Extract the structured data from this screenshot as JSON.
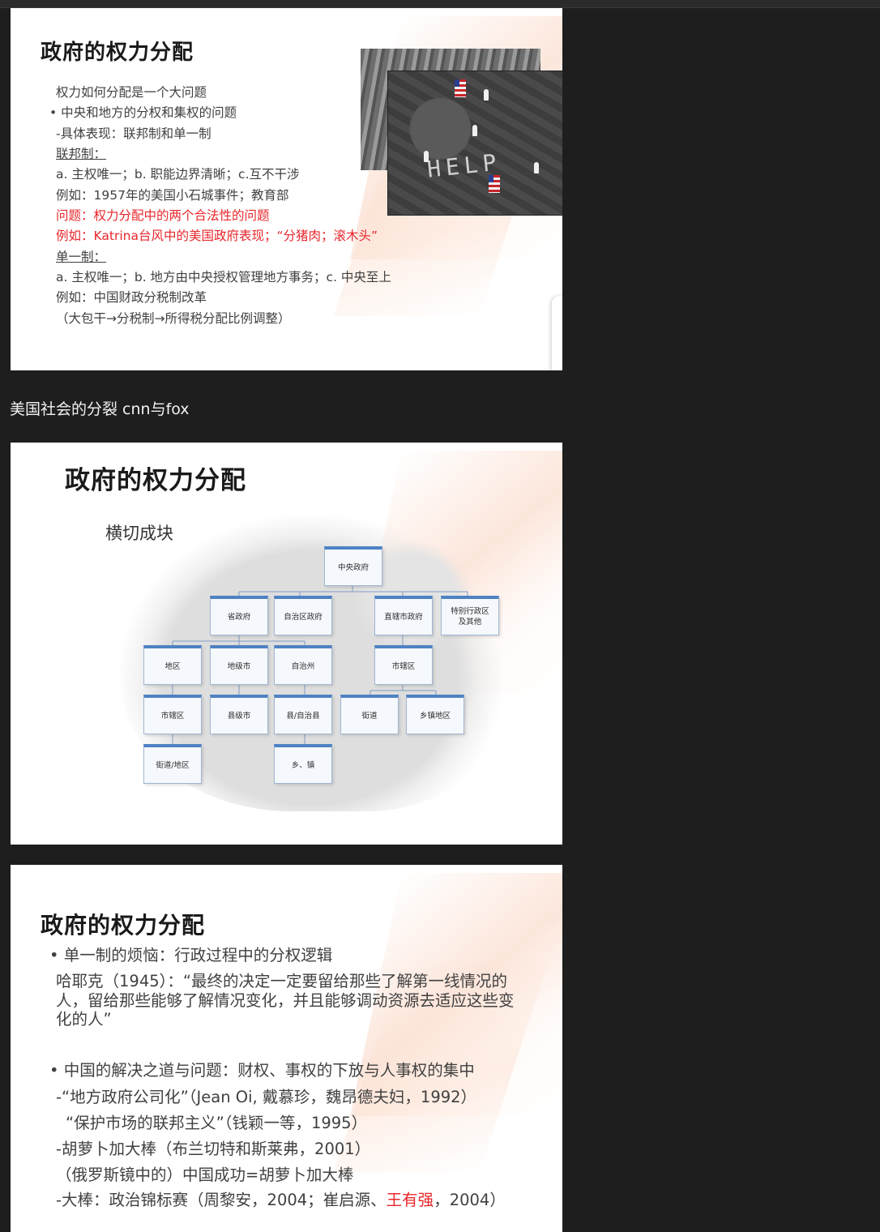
{
  "slide1": {
    "title": "政府的权力分配",
    "lines": [
      {
        "text": "权力如何分配是一个大问题"
      },
      {
        "text": "• 中央和地方的分权和集权的问题"
      },
      {
        "text": "-具体表现：联邦制和单一制"
      },
      {
        "text": "联邦制："
      },
      {
        "text": "a. 主权唯一；b. 职能边界清晰；c.互不干涉"
      },
      {
        "text": "例如：1957年的美国小石城事件；教育部"
      },
      {
        "text": "问题：权力分配中的两个合法性的问题"
      },
      {
        "text": "例如：Katrina台风中的美国政府表现；“分猪肉；滚木头”"
      },
      {
        "text": "单一制："
      },
      {
        "text": "a. 主权唯一；b. 地方由中央授权管理地方事务；c. 中央至上"
      },
      {
        "text": "例如：中国财政分税制改革"
      },
      {
        "text": "（大包干→分税制→所得税分配比例调整）"
      }
    ],
    "photo_text": "HELP"
  },
  "between_text": "美国社会的分裂  cnn与fox",
  "slide2": {
    "title": "政府的权力分配",
    "subtitle": "横切成块",
    "boxes": [
      "中央政府",
      "省政府",
      "自治区政府",
      "直辖市政府",
      "特别行政区\n及其他",
      "地区",
      "地级市",
      "自治州",
      "市辖区",
      "市辖区",
      "县级市",
      "县/自治县",
      "街道",
      "乡镇地区",
      "街道/地区",
      "乡、镇"
    ]
  },
  "slide3": {
    "title": "政府的权力分配",
    "bullet1": "• 单一制的烦恼：行政过程中的分权逻辑",
    "quote": [
      "哈耶克（1945）：“最终的决定一定要留给那些了解第一线情况的",
      "人，留给那些能够了解情况变化，并且能够调动资源去适应这些变",
      "化的人”"
    ],
    "bullet2": "• 中国的解决之道与问题：财权、事权的下放与人事权的集中",
    "items": [
      "-“地方政府公司化”（Jean Oi, 戴慕珍，魏昂德夫妇，1992）",
      "“保护市场的联邦主义”（钱颖一等，1995）",
      "-胡萝卜加大棒（布兰切特和斯莱弗，2001）",
      "（俄罗斯镜中的）中国成功=胡萝卜加大棒"
    ],
    "last_prefix": "-大棒：政治锦标赛（周黎安，2004；崔启源、",
    "last_red": "王有强",
    "last_suffix": "，2004）"
  },
  "colors": {
    "accent_red": "#e8262b",
    "box_top": "#4e82c3",
    "background": "#1e1e1e"
  }
}
